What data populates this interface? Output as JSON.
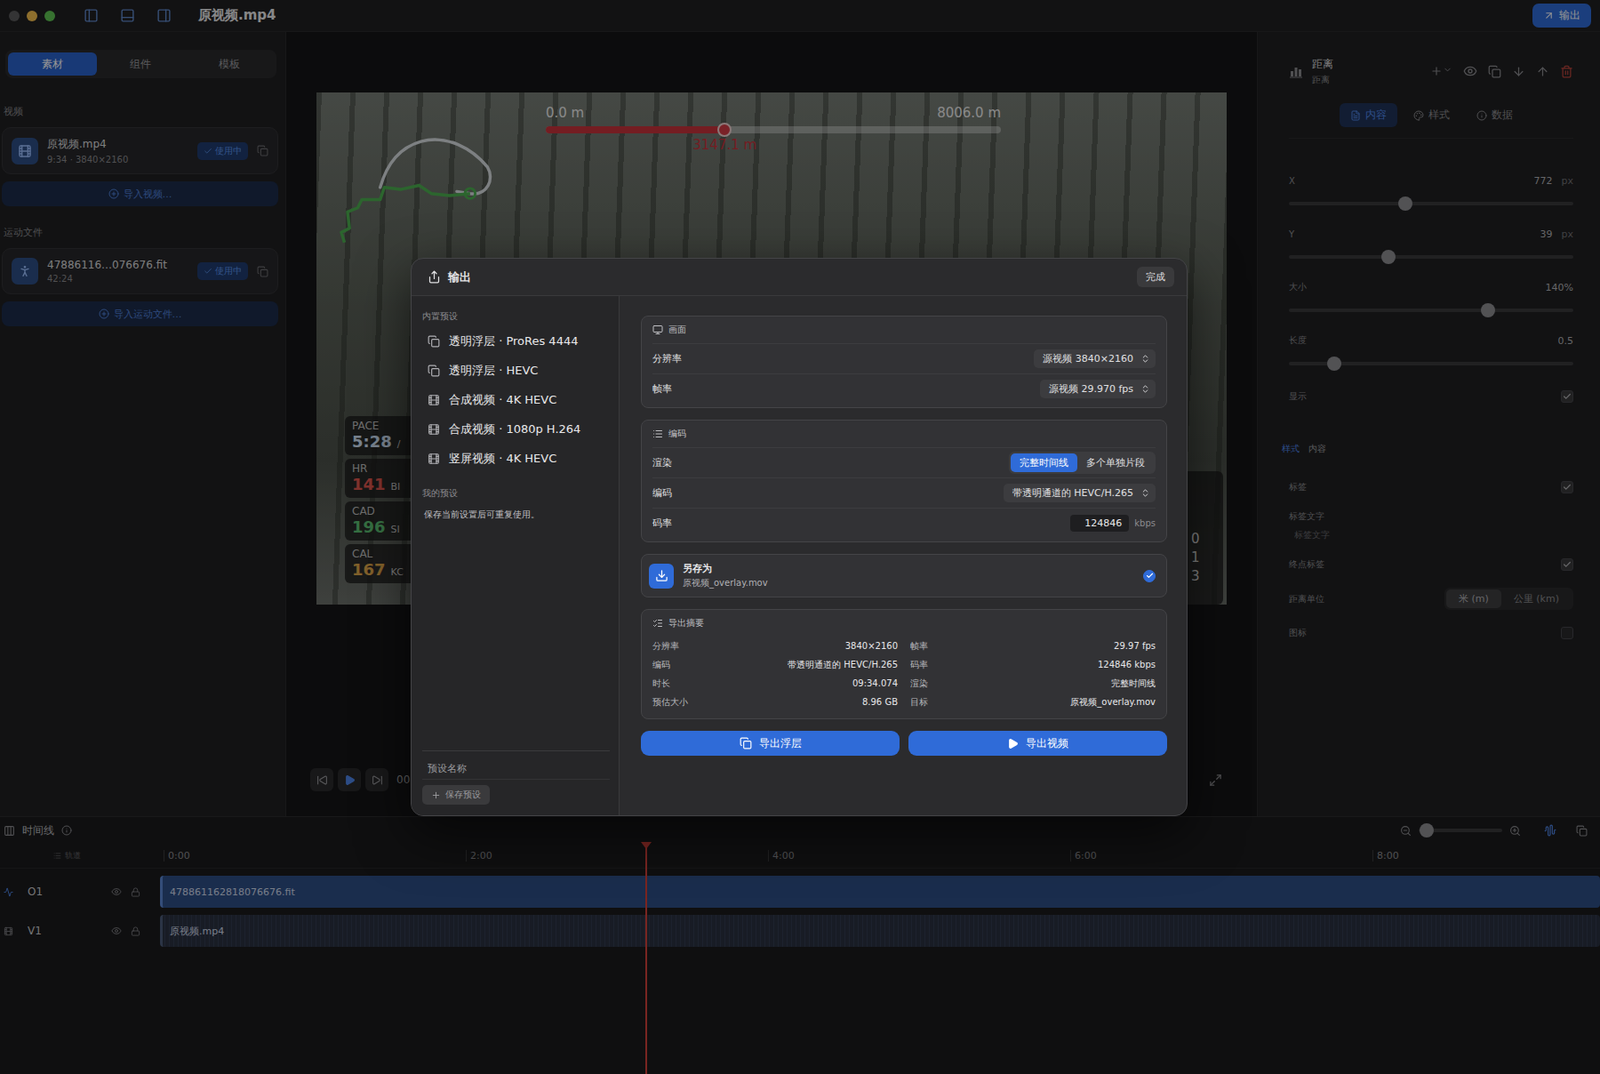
{
  "window": {
    "title": "原视频.mp4",
    "export_button": "输出"
  },
  "sidebar": {
    "tabs": [
      {
        "label": "素材",
        "selected": true
      },
      {
        "label": "组件",
        "selected": false
      },
      {
        "label": "模板",
        "selected": false
      }
    ],
    "sections": [
      {
        "title": "视频",
        "items": [
          {
            "name": "原视频.mp4",
            "meta": "9:34 · 3840×2160",
            "badge": "使用中",
            "kind": "video"
          }
        ],
        "import_button": "导入视频…"
      },
      {
        "title": "运动文件",
        "items": [
          {
            "name": "47886116…076676.fit",
            "meta": "42:24",
            "badge": "使用中",
            "kind": "activity"
          }
        ],
        "import_button": "导入运动文件…"
      }
    ]
  },
  "preview": {
    "distance": {
      "start": "0.0 m",
      "end": "8006.0 m",
      "current": "3147.1 m",
      "level": 0.393
    },
    "stats": [
      {
        "label": "PACE",
        "value": "5:28",
        "unit": "/",
        "color": "#cfe0f5"
      },
      {
        "label": "HR",
        "value": "141",
        "unit": "BI",
        "color": "#e0564f"
      },
      {
        "label": "CAD",
        "value": "196",
        "unit": "SI",
        "color": "#5cbf72"
      },
      {
        "label": "CAL",
        "value": "167",
        "unit": "KC",
        "color": "#e0a84a"
      }
    ],
    "side_digits": [
      "0",
      "1",
      "3"
    ],
    "controls": {
      "time": "00"
    }
  },
  "panel": {
    "title": "距离",
    "subtitle": "距离",
    "tabs": [
      {
        "label": "内容",
        "kind": "content",
        "selected": true
      },
      {
        "label": "样式",
        "kind": "style",
        "selected": false
      },
      {
        "label": "数据",
        "kind": "data",
        "selected": false
      }
    ],
    "fields": [
      {
        "kind": "slider",
        "label": "X",
        "value": "772",
        "unit": "px",
        "level": 0.41
      },
      {
        "kind": "slider",
        "label": "Y",
        "value": "39",
        "unit": "px",
        "level": 0.35
      },
      {
        "kind": "slider",
        "label": "大小",
        "value": "140%",
        "level": 0.7
      },
      {
        "kind": "slider",
        "label": "长度",
        "value": "0.5",
        "level": 0.16
      },
      {
        "kind": "checkbox",
        "label": "显示",
        "checked": true
      }
    ],
    "subtabs": [
      {
        "label": "样式",
        "selected": true
      },
      {
        "label": "内容",
        "selected": false
      }
    ],
    "fields2": [
      {
        "kind": "checkbox",
        "label": "标签",
        "checked": true
      },
      {
        "kind": "text",
        "label": "标签文字",
        "placeholder": "标签文字"
      },
      {
        "kind": "checkbox",
        "label": "终点标签",
        "checked": true
      },
      {
        "kind": "segmented",
        "label": "距离单位",
        "options": [
          {
            "label": "米 (m)",
            "selected": true
          },
          {
            "label": "公里 (km)",
            "selected": false
          }
        ]
      },
      {
        "kind": "checkbox",
        "label": "图标",
        "checked": false
      }
    ]
  },
  "timeline": {
    "title": "时间线",
    "tracks_label": "轨道",
    "zoom": {
      "level": 0.1
    },
    "ticks": [
      "0:00",
      "2:00",
      "4:00",
      "6:00",
      "8:00"
    ],
    "tracks": [
      {
        "id": "O1",
        "clip": "478861162818076676.fit",
        "kind": "activity"
      },
      {
        "id": "V1",
        "clip": "原视频.mp4",
        "kind": "video"
      }
    ],
    "playhead": {
      "level": 0.337
    }
  },
  "dialog": {
    "title": "输出",
    "done": "完成",
    "presets_heading": "内置预设",
    "presets": [
      {
        "label": "透明浮层 · ProRes 4444",
        "kind": "overlay"
      },
      {
        "label": "透明浮层 · HEVC",
        "kind": "overlay"
      },
      {
        "label": "合成视频 · 4K HEVC",
        "kind": "composite"
      },
      {
        "label": "合成视频 · 1080p H.264",
        "kind": "composite"
      },
      {
        "label": "竖屏视频 · 4K HEVC",
        "kind": "composite"
      }
    ],
    "my_presets_heading": "我的预设",
    "my_presets_hint": "保存当前设置后可重复使用。",
    "preset_name_placeholder": "预设名称",
    "save_preset": "保存预设",
    "picture": {
      "title": "画面",
      "rows": [
        {
          "label": "分辨率",
          "value": "源视频 3840×2160"
        },
        {
          "label": "帧率",
          "value": "源视频 29.970 fps"
        }
      ]
    },
    "encoding": {
      "title": "编码",
      "render": {
        "label": "渲染",
        "options": [
          {
            "label": "完整时间线",
            "selected": true
          },
          {
            "label": "多个单独片段",
            "selected": false
          }
        ]
      },
      "codec": {
        "label": "编码",
        "value": "带透明通道的 HEVC/H.265"
      },
      "bitrate": {
        "label": "码率",
        "value": "124846",
        "unit": "kbps"
      }
    },
    "save_as": {
      "title": "另存为",
      "file": "原视频_overlay.mov",
      "checked": true
    },
    "summary": {
      "title": "导出摘要",
      "items": [
        {
          "label": "分辨率",
          "value": "3840×2160"
        },
        {
          "label": "帧率",
          "value": "29.97 fps"
        },
        {
          "label": "编码",
          "value": "带透明通道的 HEVC/H.265"
        },
        {
          "label": "码率",
          "value": "124846 kbps"
        },
        {
          "label": "时长",
          "value": "09:34.074"
        },
        {
          "label": "渲染",
          "value": "完整时间线"
        },
        {
          "label": "预估大小",
          "value": "8.96 GB"
        },
        {
          "label": "目标",
          "value": "原视频_overlay.mov"
        }
      ]
    },
    "export_overlay": "导出浮层",
    "export_video": "导出视频"
  }
}
